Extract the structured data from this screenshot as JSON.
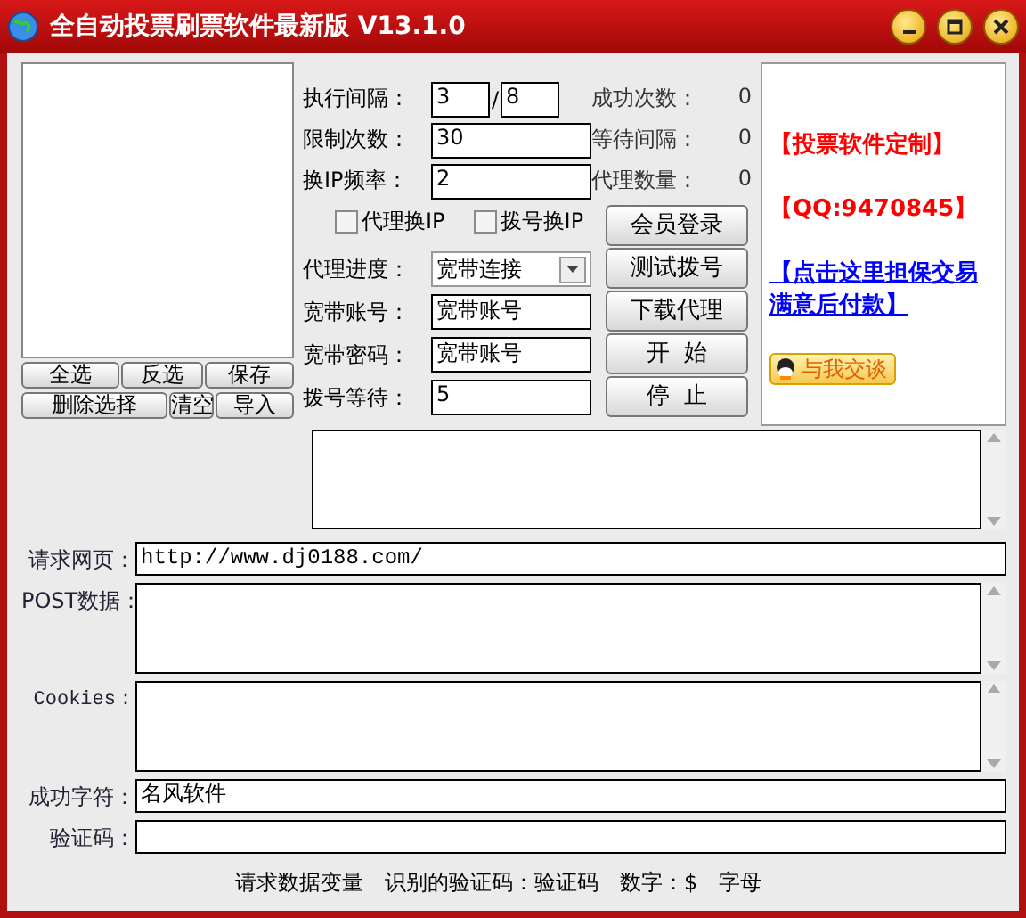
{
  "window": {
    "title": "全自动投票刷票软件最新版 V13.1.0"
  },
  "list_buttons": [
    {
      "label": "全选"
    },
    {
      "label": "反选"
    },
    {
      "label": "保存"
    },
    {
      "label": "删除选择"
    },
    {
      "label": "清空"
    },
    {
      "label": "导入"
    }
  ],
  "interval": {
    "label": "执行间隔：",
    "from": "3",
    "separator": "/",
    "to": "8"
  },
  "fields": [
    {
      "label": "限制次数：",
      "value": "30"
    },
    {
      "label": "换IP频率：",
      "value": "2"
    }
  ],
  "stats": [
    {
      "label": "成功次数：",
      "value": "0"
    },
    {
      "label": "等待间隔：",
      "value": "0"
    },
    {
      "label": "代理数量：",
      "value": "0"
    }
  ],
  "checkboxes": [
    {
      "label": "代理换IP",
      "checked": false
    },
    {
      "label": "拨号换IP",
      "checked": false
    }
  ],
  "proxy_progress": {
    "label": "代理进度：",
    "value": "宽带连接"
  },
  "dial_fields": [
    {
      "label": "宽带账号：",
      "value": "宽带账号"
    },
    {
      "label": "宽带密码：",
      "value": "宽带账号"
    },
    {
      "label": "拨号等待：",
      "value": "5"
    }
  ],
  "action_buttons": [
    "会员登录",
    "测试拨号",
    "下载代理",
    "开  始",
    "停  止"
  ],
  "ad_panel": [
    {
      "kind": "red",
      "text": "【投票软件定制】"
    },
    {
      "kind": "red",
      "text": "【QQ:9470845】"
    },
    {
      "kind": "link",
      "text": "【点击这里担保交易满意后付款】"
    },
    {
      "kind": "chat",
      "text": "与我交谈"
    }
  ],
  "request": [
    {
      "kind": "line",
      "label": "请求网页：",
      "value": "http://www.dj0188.com/"
    },
    {
      "kind": "area",
      "label": "POST数据："
    },
    {
      "kind": "area",
      "label": "Cookies："
    },
    {
      "kind": "line",
      "label": "成功字符：",
      "value": "名风软件"
    },
    {
      "kind": "line",
      "label": "验证码："
    }
  ],
  "status_bar": [
    "请求数据变量",
    "识别的验证码：验证码",
    "数字：$",
    "字母"
  ]
}
